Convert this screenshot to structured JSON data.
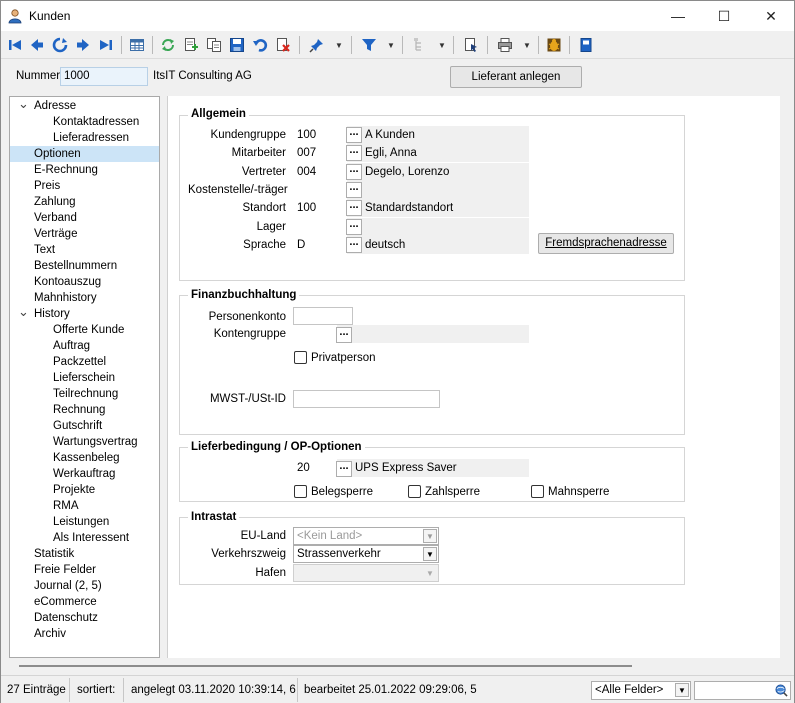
{
  "window": {
    "title": "Kunden",
    "controls": {
      "minimize": "—",
      "maximize": "☐",
      "close": "✕"
    }
  },
  "toolbar": {
    "icons": [
      "first-icon",
      "prev-icon",
      "refresh-record-icon",
      "next-icon",
      "last-icon",
      "table-view-icon",
      "reload-icon",
      "new-record-icon",
      "copy-icon",
      "save-icon",
      "undo-icon",
      "delete-icon",
      "pin-icon",
      "filter-icon",
      "hierarchy-icon",
      "document-link-icon",
      "print-icon",
      "bug-icon",
      "help-book-icon"
    ]
  },
  "header": {
    "nummer_label": "Nummer",
    "nummer_value": "1000",
    "company_name": "ItsIT Consulting AG",
    "lieferant_button": "Lieferant anlegen"
  },
  "tree": {
    "items": [
      {
        "label": "Adresse",
        "level": 0,
        "expanded": true
      },
      {
        "label": "Kontaktadressen",
        "level": 1
      },
      {
        "label": "Lieferadressen",
        "level": 1
      },
      {
        "label": "Optionen",
        "level": 0,
        "selected": true
      },
      {
        "label": "E-Rechnung",
        "level": 0
      },
      {
        "label": "Preis",
        "level": 0
      },
      {
        "label": "Zahlung",
        "level": 0
      },
      {
        "label": "Verband",
        "level": 0
      },
      {
        "label": "Verträge",
        "level": 0
      },
      {
        "label": "Text",
        "level": 0
      },
      {
        "label": "Bestellnummern",
        "level": 0
      },
      {
        "label": "Kontoauszug",
        "level": 0
      },
      {
        "label": "Mahnhistory",
        "level": 0
      },
      {
        "label": "History",
        "level": 0,
        "expanded": true
      },
      {
        "label": "Offerte Kunde",
        "level": 1
      },
      {
        "label": "Auftrag",
        "level": 1
      },
      {
        "label": "Packzettel",
        "level": 1
      },
      {
        "label": "Lieferschein",
        "level": 1
      },
      {
        "label": "Teilrechnung",
        "level": 1
      },
      {
        "label": "Rechnung",
        "level": 1
      },
      {
        "label": "Gutschrift",
        "level": 1
      },
      {
        "label": "Wartungsvertrag",
        "level": 1
      },
      {
        "label": "Kassenbeleg",
        "level": 1
      },
      {
        "label": "Werkauftrag",
        "level": 1
      },
      {
        "label": "Projekte",
        "level": 1
      },
      {
        "label": "RMA",
        "level": 1
      },
      {
        "label": "Leistungen",
        "level": 1
      },
      {
        "label": "Als Interessent",
        "level": 1
      },
      {
        "label": "Statistik",
        "level": 0
      },
      {
        "label": "Freie Felder",
        "level": 0
      },
      {
        "label": "Journal (2, 5)",
        "level": 0
      },
      {
        "label": "eCommerce",
        "level": 0
      },
      {
        "label": "Datenschutz",
        "level": 0
      },
      {
        "label": "Archiv",
        "level": 0
      }
    ]
  },
  "allgemein": {
    "title": "Allgemein",
    "rows": [
      {
        "label": "Kundengruppe",
        "value": "100",
        "desc": "A Kunden"
      },
      {
        "label": "Mitarbeiter",
        "value": "007",
        "desc": "Egli, Anna"
      },
      {
        "label": "Vertreter",
        "value": "004",
        "desc": "Degelo, Lorenzo"
      },
      {
        "label": "Kostenstelle/-träger",
        "value": "",
        "desc": ""
      },
      {
        "label": "Standort",
        "value": "100",
        "desc": "Standardstandort"
      },
      {
        "label": "Lager",
        "value": "",
        "desc": ""
      },
      {
        "label": "Sprache",
        "value": "D",
        "desc": "deutsch"
      }
    ],
    "dots": "...",
    "fremdsprachen_button": "Fremdsprachenadresse"
  },
  "finanz": {
    "title": "Finanzbuchhaltung",
    "personenkonto_label": "Personenkonto",
    "personenkonto_value": "",
    "kontengruppe_label": "Kontengruppe",
    "kontengruppe_value": "",
    "privatperson_label": "Privatperson",
    "privatperson_checked": false,
    "mwst_label": "MWST-/USt-ID",
    "mwst_value": ""
  },
  "lieferbedingung": {
    "title": "Lieferbedingung / OP-Optionen",
    "value": "20",
    "desc": "UPS Express Saver",
    "belegsperre_label": "Belegsperre",
    "zahlsperre_label": "Zahlsperre",
    "mahnsperre_label": "Mahnsperre"
  },
  "intrastat": {
    "title": "Intrastat",
    "euland_label": "EU-Land",
    "euland_value": "<Kein Land>",
    "verkehr_label": "Verkehrszweig",
    "verkehr_value": "Strassenverkehr",
    "hafen_label": "Hafen",
    "hafen_value": ""
  },
  "status": {
    "entries": "27 Einträge",
    "sorted": "sortiert:",
    "created": "angelegt 03.11.2020 10:39:14,  6",
    "edited": "bearbeitet 25.01.2022 09:29:06,  5",
    "field_filter": "<Alle Felder>",
    "search_value": ""
  },
  "colors": {
    "selection": "#cce4f7",
    "accent_blue": "#1f64c4",
    "input_highlight": "#eaf3fb"
  }
}
